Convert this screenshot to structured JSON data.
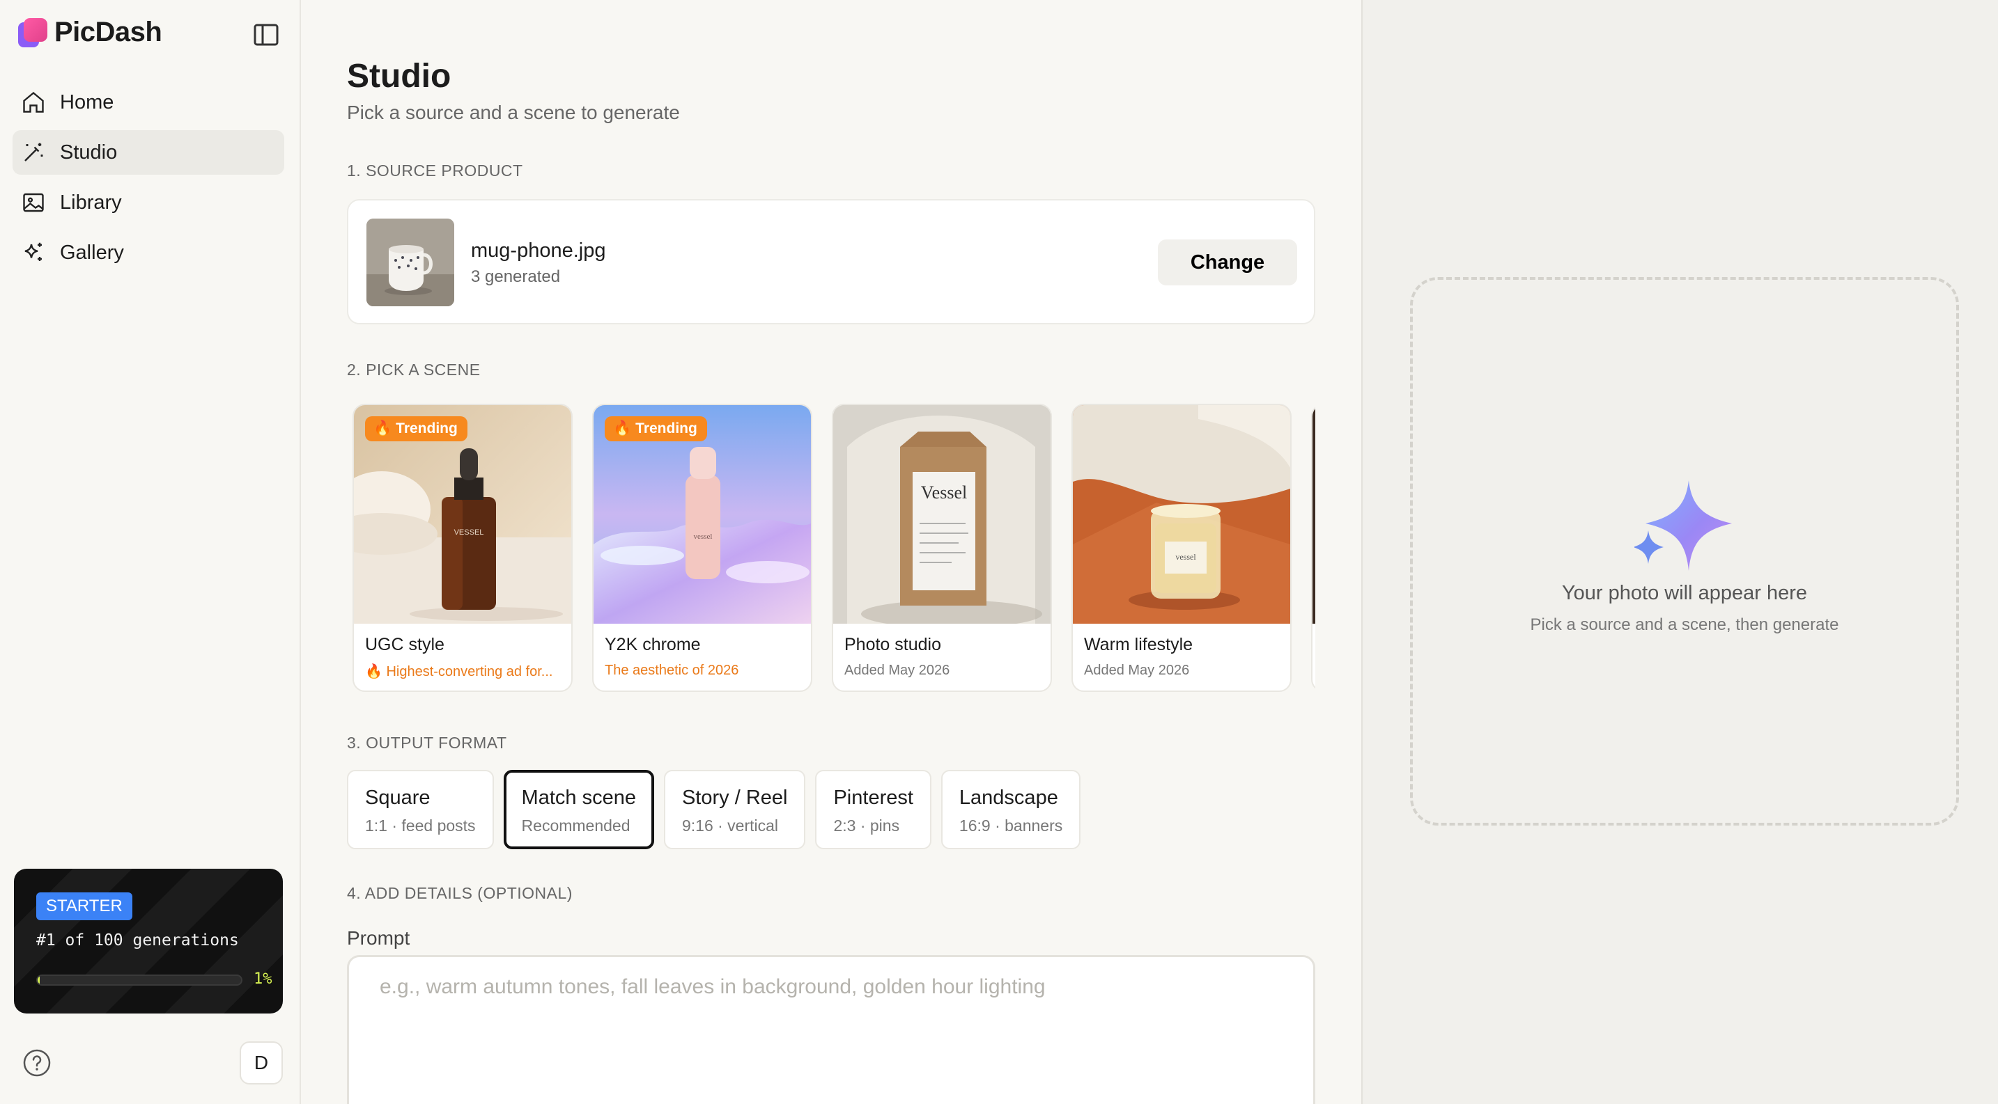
{
  "app": {
    "name": "PicDash"
  },
  "sidebar": {
    "items": [
      {
        "label": "Home",
        "icon": "home-icon",
        "active": false
      },
      {
        "label": "Studio",
        "icon": "magic-wand-icon",
        "active": true
      },
      {
        "label": "Library",
        "icon": "image-icon",
        "active": false
      },
      {
        "label": "Gallery",
        "icon": "sparkles-icon",
        "active": false
      }
    ],
    "plan": {
      "badge": "STARTER",
      "text": "#1 of 100 generations",
      "progress_percent": 1,
      "progress_label": "1%"
    },
    "avatar_initial": "D"
  },
  "main": {
    "title": "Studio",
    "subtitle": "Pick a source and a scene to generate",
    "source": {
      "section_label": "1. SOURCE PRODUCT",
      "file_name": "mug-phone.jpg",
      "meta": "3 generated",
      "change_label": "Change"
    },
    "scenes": {
      "section_label": "2. PICK A SCENE",
      "items": [
        {
          "name": "UGC style",
          "desc": "🔥 Highest-converting ad for...",
          "badge": "Trending",
          "hot": true
        },
        {
          "name": "Y2K chrome",
          "desc": "The aesthetic of 2026",
          "badge": "Trending",
          "hot": true
        },
        {
          "name": "Photo studio",
          "desc": "Added May 2026",
          "badge": "",
          "hot": false
        },
        {
          "name": "Warm lifestyle",
          "desc": "Added May 2026",
          "badge": "",
          "hot": false
        }
      ],
      "product_labels": {
        "dropper": "VESSEL",
        "chrome": "vessel",
        "bag": "Vessel",
        "candle": "vessel"
      }
    },
    "output": {
      "section_label": "3. OUTPUT FORMAT",
      "formats": [
        {
          "title": "Square",
          "sub": "1:1 · feed posts",
          "selected": false
        },
        {
          "title": "Match scene",
          "sub": "Recommended",
          "selected": true
        },
        {
          "title": "Story / Reel",
          "sub": "9:16 · vertical",
          "selected": false
        },
        {
          "title": "Pinterest",
          "sub": "2:3 · pins",
          "selected": false
        },
        {
          "title": "Landscape",
          "sub": "16:9 · banners",
          "selected": false
        }
      ]
    },
    "details": {
      "section_label": "4. ADD DETAILS (OPTIONAL)",
      "prompt_label": "Prompt",
      "prompt_placeholder": "e.g., warm autumn tones, fall leaves in background, golden hour lighting",
      "prompt_value": ""
    }
  },
  "preview": {
    "title": "Your photo will appear here",
    "subtitle": "Pick a source and a scene, then generate"
  },
  "colors": {
    "accent_orange": "#f7891e",
    "plan_badge": "#3b82f6",
    "progress": "#d7f253"
  }
}
